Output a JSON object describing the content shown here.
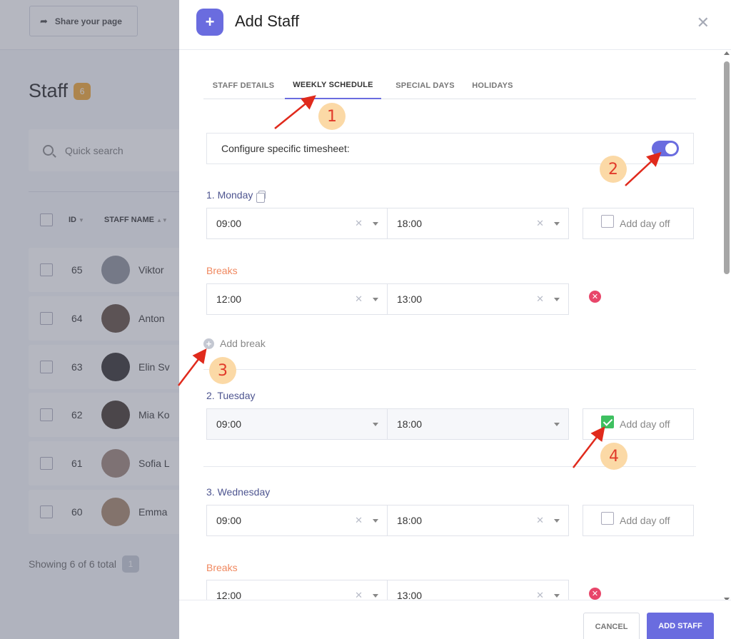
{
  "background": {
    "share_button": "Share your page",
    "page_title": "Staff",
    "staff_count": "6",
    "search_placeholder": "Quick search",
    "columns": {
      "id": "ID",
      "name": "STAFF NAME"
    },
    "rows": [
      {
        "id": "65",
        "name": "Viktor",
        "avatar_color": "#8a8f98"
      },
      {
        "id": "64",
        "name": "Anton",
        "avatar_color": "#5d4a3c"
      },
      {
        "id": "63",
        "name": "Elin Sv",
        "avatar_color": "#2e2a2a"
      },
      {
        "id": "62",
        "name": "Mia Ko",
        "avatar_color": "#3e3228"
      },
      {
        "id": "61",
        "name": "Sofia L",
        "avatar_color": "#9b8176"
      },
      {
        "id": "60",
        "name": "Emma",
        "avatar_color": "#a48467"
      }
    ],
    "footer_text": "Showing 6 of 6 total",
    "footer_page": "1"
  },
  "modal": {
    "title": "Add Staff",
    "tabs": [
      "STAFF DETAILS",
      "WEEKLY SCHEDULE",
      "SPECIAL DAYS",
      "HOLIDAYS"
    ],
    "active_tab": "WEEKLY SCHEDULE",
    "timesheet_label": "Configure specific timesheet:",
    "timesheet_enabled": true,
    "add_break_label": "Add break",
    "breaks_label": "Breaks",
    "day_off_label": "Add day off",
    "days": [
      {
        "label": "1. Monday",
        "start": "09:00",
        "end": "18:00",
        "day_off": false,
        "break_start": "12:00",
        "break_end": "13:00"
      },
      {
        "label": "2. Tuesday",
        "start": "09:00",
        "end": "18:00",
        "day_off": true
      },
      {
        "label": "3. Wednesday",
        "start": "09:00",
        "end": "18:00",
        "day_off": false,
        "break_start": "12:00",
        "break_end": "13:00"
      }
    ],
    "cancel_label": "CANCEL",
    "submit_label": "ADD STAFF"
  },
  "annotations": [
    "1",
    "2",
    "3",
    "4"
  ],
  "colors": {
    "accent": "#6a6cdf",
    "breaks": "#f0885f",
    "remove": "#e8466a",
    "checked": "#3ec060",
    "annotation": "#e13a2a"
  }
}
